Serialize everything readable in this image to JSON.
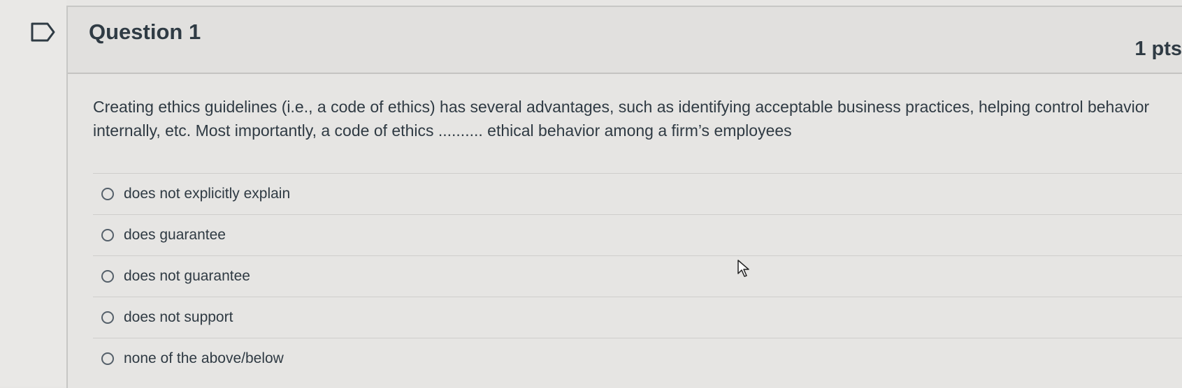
{
  "question": {
    "title": "Question 1",
    "points": "1 pts",
    "text": "Creating ethics guidelines (i.e., a code of ethics) has several advantages, such as identifying acceptable business practices, helping control behavior internally, etc. Most importantly, a code of ethics .......... ethical behavior among a firm’s employees"
  },
  "answers": [
    {
      "label": "does not explicitly explain"
    },
    {
      "label": "does guarantee"
    },
    {
      "label": "does not guarantee"
    },
    {
      "label": "does not support"
    },
    {
      "label": "none of the above/below"
    }
  ],
  "icons": {
    "flag": "flag-question-icon",
    "radio": "radio-unselected-icon",
    "cursor": "mouse-pointer-icon"
  }
}
